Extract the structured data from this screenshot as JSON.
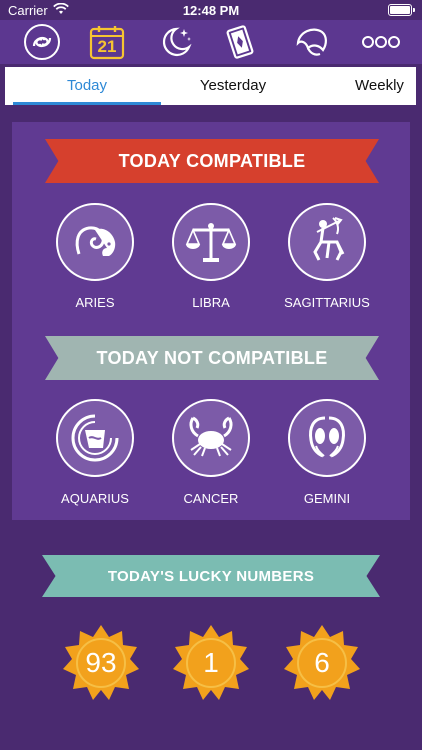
{
  "status": {
    "carrier": "Carrier",
    "time": "12:48 PM"
  },
  "toolbar": {
    "items": [
      {
        "icon": "pisces-icon"
      },
      {
        "icon": "calendar-icon",
        "day": "21"
      },
      {
        "icon": "moon-stars-icon"
      },
      {
        "icon": "tarot-card-icon"
      },
      {
        "icon": "fortune-cookie-icon"
      },
      {
        "icon": "more-icon"
      }
    ]
  },
  "tabs": [
    {
      "label": "Today",
      "active": true
    },
    {
      "label": "Yesterday",
      "active": false
    },
    {
      "label": "Weekly",
      "active": false
    }
  ],
  "compatible": {
    "title": "TODAY COMPATIBLE",
    "signs": [
      {
        "name": "ARIES",
        "icon": "aries-icon"
      },
      {
        "name": "LIBRA",
        "icon": "libra-icon"
      },
      {
        "name": "SAGITTARIUS",
        "icon": "sagittarius-icon"
      }
    ]
  },
  "not_compatible": {
    "title": "TODAY NOT COMPATIBLE",
    "signs": [
      {
        "name": "AQUARIUS",
        "icon": "aquarius-icon"
      },
      {
        "name": "CANCER",
        "icon": "cancer-icon"
      },
      {
        "name": "GEMINI",
        "icon": "gemini-icon"
      }
    ]
  },
  "lucky": {
    "title": "TODAY'S LUCKY NUMBERS",
    "numbers": [
      "93",
      "1",
      "6"
    ]
  },
  "colors": {
    "background": "#4a2a70",
    "card": "#603a92",
    "accent_blue": "#2e89d6",
    "ribbon_red": "#d6402d",
    "ribbon_gray": "#a0b5b1",
    "ribbon_teal": "#7bbcb2",
    "lucky_orange": "#f2a11c"
  }
}
